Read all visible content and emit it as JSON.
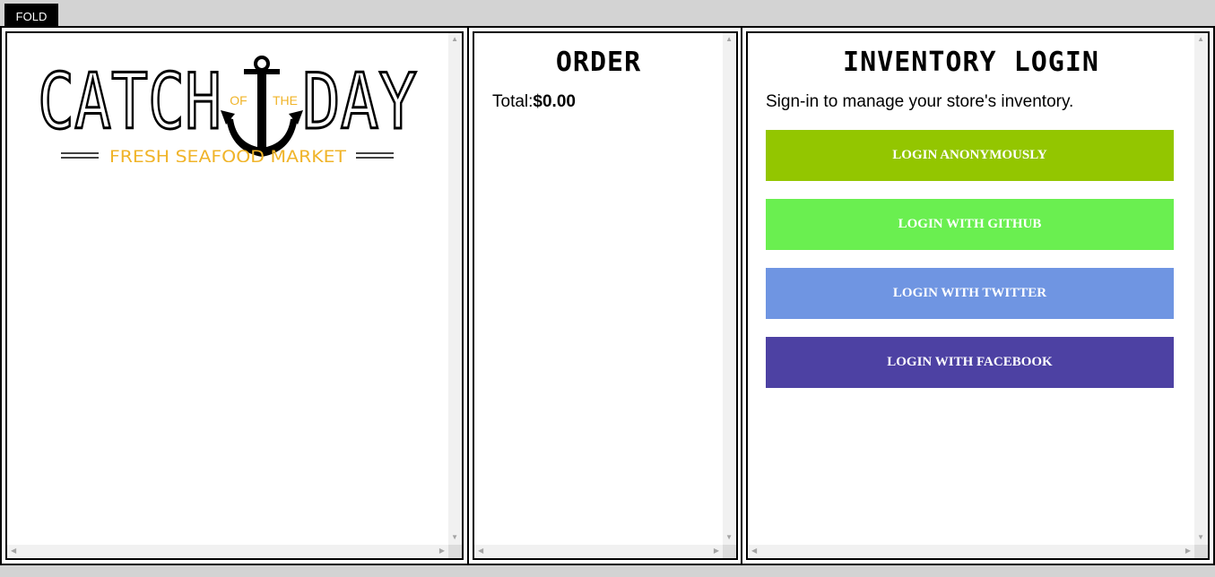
{
  "fold_label": "FOLD",
  "logo": {
    "word_left": "CATCH",
    "word_of": "OF",
    "word_the": "THE",
    "word_right": "DAY",
    "tagline": "FRESH SEAFOOD MARKET",
    "accent_color": "#f0b429"
  },
  "order": {
    "title": "ORDER",
    "total_label": "Total:",
    "total_value": "$0.00"
  },
  "inventory": {
    "title": "INVENTORY LOGIN",
    "description": "Sign-in to manage your store's inventory.",
    "buttons": [
      {
        "label": "LOGIN ANONYMOUSLY",
        "color": "#93c600"
      },
      {
        "label": "LOGIN WITH GITHUB",
        "color": "#6aef50"
      },
      {
        "label": "LOGIN WITH TWITTER",
        "color": "#6f95e2"
      },
      {
        "label": "LOGIN WITH FACEBOOK",
        "color": "#4d41a3"
      }
    ]
  }
}
